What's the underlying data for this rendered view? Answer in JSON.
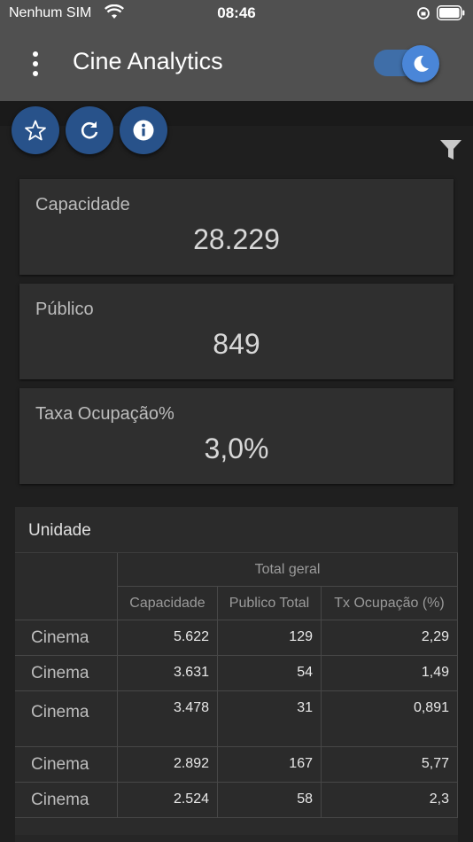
{
  "status_bar": {
    "carrier": "Nenhum SIM",
    "time": "08:46"
  },
  "app_bar": {
    "title": "Cine Analytics",
    "dark_mode_enabled": true
  },
  "kpis": [
    {
      "label": "Capacidade",
      "value": "28.229"
    },
    {
      "label": "Público",
      "value": "849"
    },
    {
      "label": "Taxa Ocupação%",
      "value": "3,0%"
    }
  ],
  "table": {
    "title": "Unidade",
    "group_header": "Total geral",
    "columns": [
      "Capacidade",
      "Publico Total",
      "Tx Ocupação (%)"
    ],
    "rows": [
      {
        "label": "Cinema",
        "capacidade": "5.622",
        "publico": "129",
        "taxa": "2,29"
      },
      {
        "label": "Cinema",
        "capacidade": "3.631",
        "publico": "54",
        "taxa": "1,49"
      },
      {
        "label": "Cinema",
        "capacidade": "3.478",
        "publico": "31",
        "taxa": "0,891"
      },
      {
        "label": "Cinema",
        "capacidade": "2.892",
        "publico": "167",
        "taxa": "5,77"
      },
      {
        "label": "Cinema",
        "capacidade": "2.524",
        "publico": "58",
        "taxa": "2,3"
      }
    ]
  },
  "colors": {
    "app_bar": "#505050",
    "accent": "#4a86d8",
    "fab": "#28528a",
    "card": "#2f2f2f"
  }
}
